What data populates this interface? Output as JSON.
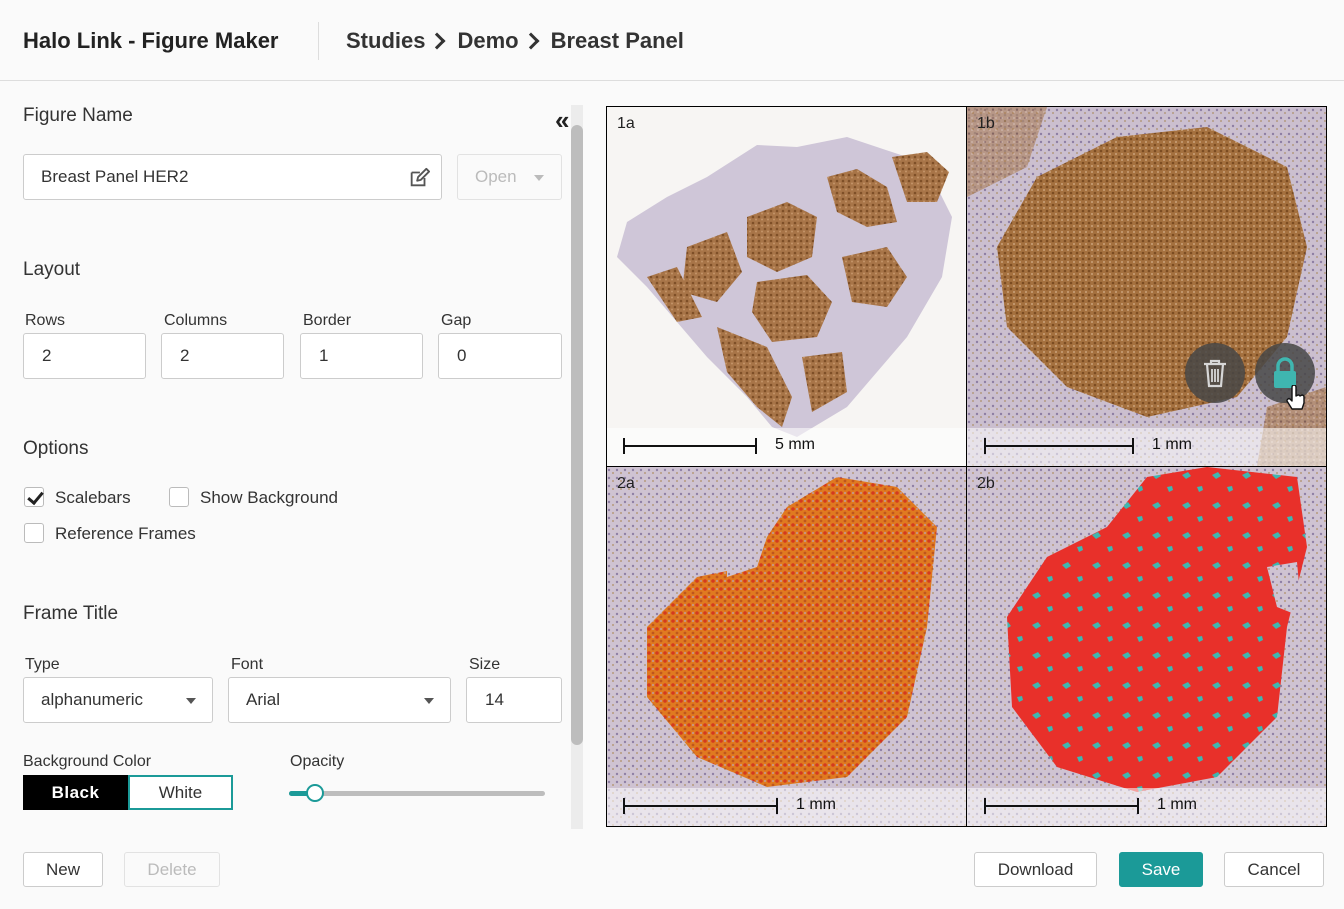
{
  "header": {
    "app_title": "Halo Link - Figure Maker",
    "breadcrumb": [
      "Studies",
      "Demo",
      "Breast Panel"
    ]
  },
  "figure_name": {
    "title": "Figure Name",
    "value": "Breast Panel HER2",
    "open_label": "Open"
  },
  "layout": {
    "title": "Layout",
    "rows_label": "Rows",
    "rows": "2",
    "columns_label": "Columns",
    "columns": "2",
    "border_label": "Border",
    "border": "1",
    "gap_label": "Gap",
    "gap": "0"
  },
  "options": {
    "title": "Options",
    "scalebars_label": "Scalebars",
    "scalebars_checked": true,
    "show_background_label": "Show Background",
    "show_background_checked": false,
    "reference_frames_label": "Reference Frames",
    "reference_frames_checked": false
  },
  "frame_title": {
    "title": "Frame Title",
    "type_label": "Type",
    "type_value": "alphanumeric",
    "font_label": "Font",
    "font_value": "Arial",
    "size_label": "Size",
    "size_value": "14",
    "background_color_label": "Background Color",
    "black_label": "Black",
    "white_label": "White",
    "selected_color": "White",
    "opacity_label": "Opacity",
    "opacity_fraction": 0.1
  },
  "footer": {
    "new_label": "New",
    "delete_label": "Delete",
    "download_label": "Download",
    "save_label": "Save",
    "cancel_label": "Cancel"
  },
  "frames": [
    {
      "title": "1a",
      "scale": "5 mm",
      "selected": true
    },
    {
      "title": "1b",
      "scale": "1 mm",
      "selected": false
    },
    {
      "title": "2a",
      "scale": "1 mm",
      "selected": false
    },
    {
      "title": "2b",
      "scale": "1 mm",
      "selected": false
    }
  ],
  "colors": {
    "accent": "#1b9a98",
    "selected_frame": "#1a8a1a",
    "stain_brown": "#9e6a3a",
    "markup_red": "#e8302a",
    "markup_orange": "#e07a20",
    "markup_teal": "#3fb6b0",
    "tissue_purple": "#c4b8cf"
  },
  "icons": {
    "edit": "edit-icon",
    "collapse": "double-chevron-left-icon",
    "trash": "trash-icon",
    "lock": "lock-icon"
  }
}
